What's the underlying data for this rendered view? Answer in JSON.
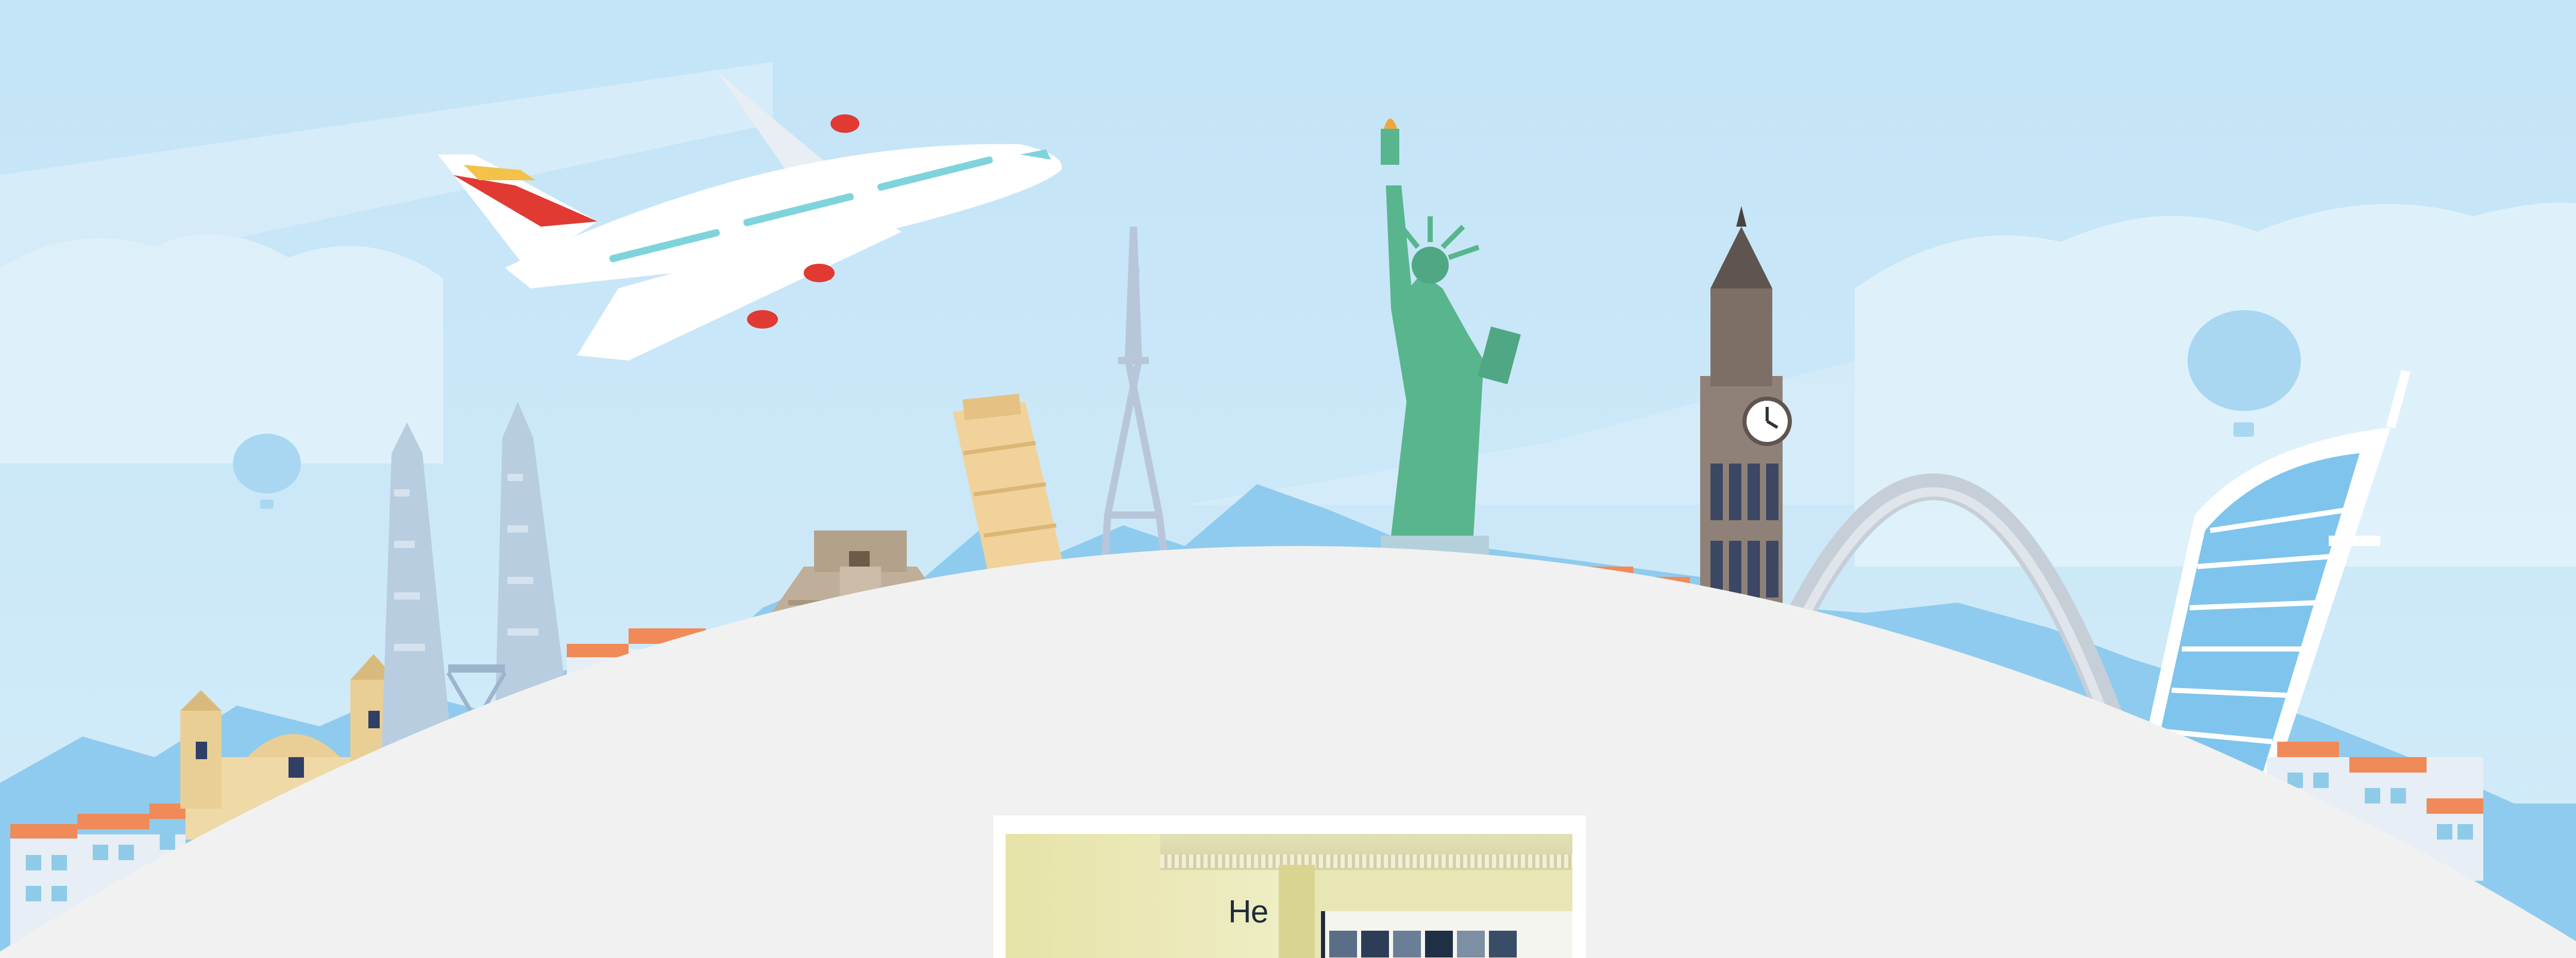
{
  "scene": {
    "colors": {
      "sky": "#bfe3f6",
      "ground": "#f1f1f1",
      "mountains": "#8fcbee",
      "plane_tail": "#e03a32",
      "liberty": "#59b58d"
    },
    "icons": [
      "airplane-icon",
      "hot-air-balloon-icon",
      "petronas-towers-icon",
      "mayan-pyramid-icon",
      "leaning-tower-icon",
      "eiffel-tower-icon",
      "statue-of-liberty-icon",
      "big-ben-icon",
      "gateway-arch-icon",
      "burj-al-arab-icon",
      "cathedral-icon"
    ]
  },
  "photo": {
    "screen_text": "He"
  }
}
